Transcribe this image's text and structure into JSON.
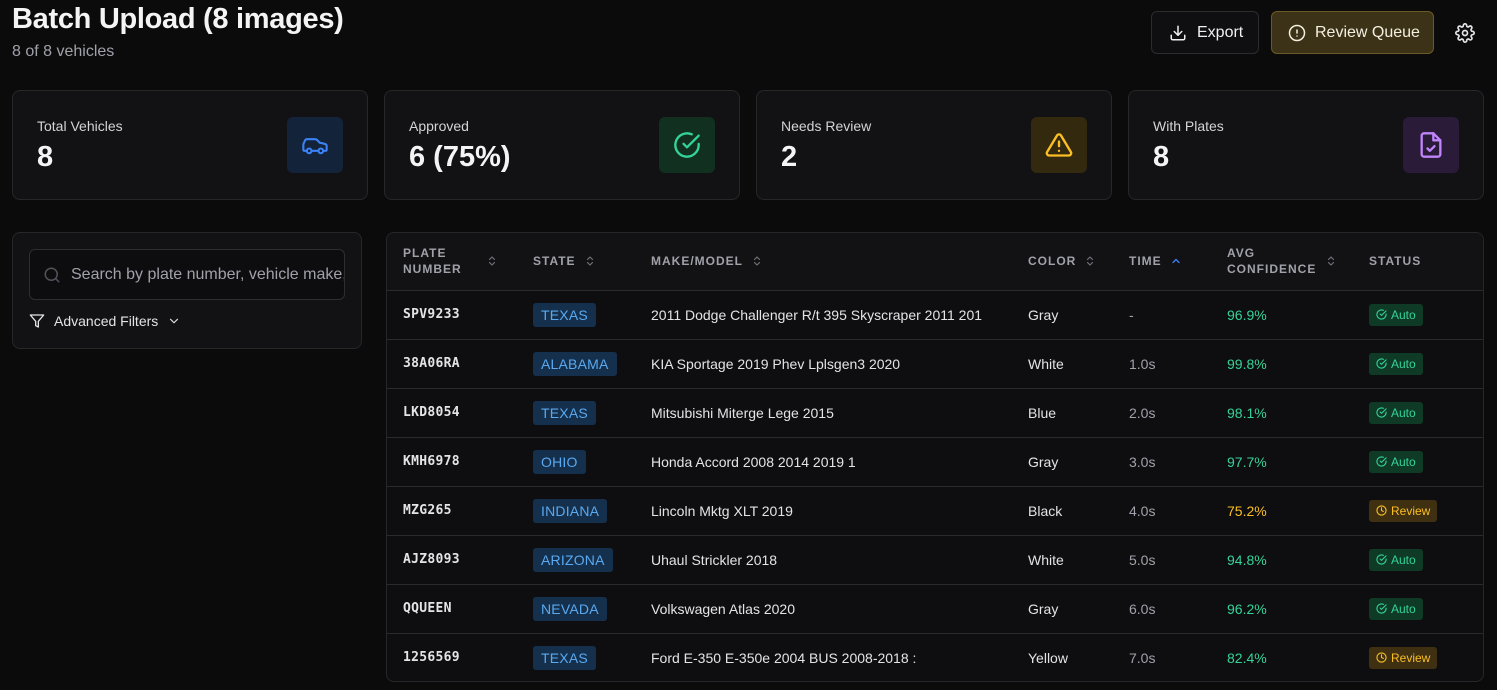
{
  "header": {
    "title": "Batch Upload (8 images)",
    "subtitle": "8 of 8 vehicles"
  },
  "toolbar": {
    "export_label": "Export",
    "review_queue_label": "Review Queue"
  },
  "stats": [
    {
      "label": "Total Vehicles",
      "value": "8",
      "icon": "car-icon",
      "color": "#3b82f6"
    },
    {
      "label": "Approved",
      "value": "6 (75%)",
      "icon": "check-circle-icon",
      "color": "#34d399"
    },
    {
      "label": "Needs Review",
      "value": "2",
      "icon": "warning-triangle-icon",
      "color": "#fbbf24"
    },
    {
      "label": "With Plates",
      "value": "8",
      "icon": "file-check-icon",
      "color": "#c084fc"
    }
  ],
  "filters": {
    "search_placeholder": "Search by plate number, vehicle make, model...",
    "advanced_label": "Advanced Filters"
  },
  "table": {
    "columns": [
      "Plate Number",
      "State",
      "Make/Model",
      "Color",
      "Time",
      "Avg Confidence",
      "Status"
    ],
    "rows": [
      {
        "plate": "SPV9233",
        "state": "TEXAS",
        "make_model": "2011 Dodge Challenger R/t 395 Skyscraper 2011 201",
        "color": "Gray",
        "time": "-",
        "confidence": "96.9%",
        "status": "Auto"
      },
      {
        "plate": "38A06RA",
        "state": "ALABAMA",
        "make_model": "KIA Sportage 2019 Phev Lplsgen3 2020",
        "color": "White",
        "time": "1.0s",
        "confidence": "99.8%",
        "status": "Auto"
      },
      {
        "plate": "LKD8054",
        "state": "TEXAS",
        "make_model": "Mitsubishi Miterge Lege 2015",
        "color": "Blue",
        "time": "2.0s",
        "confidence": "98.1%",
        "status": "Auto"
      },
      {
        "plate": "KMH6978",
        "state": "OHIO",
        "make_model": "Honda Accord 2008 2014 2019 1",
        "color": "Gray",
        "time": "3.0s",
        "confidence": "97.7%",
        "status": "Auto"
      },
      {
        "plate": "MZG265",
        "state": "INDIANA",
        "make_model": "Lincoln Mktg XLT 2019",
        "color": "Black",
        "time": "4.0s",
        "confidence": "75.2%",
        "status": "Review"
      },
      {
        "plate": "AJZ8093",
        "state": "ARIZONA",
        "make_model": "Uhaul Strickler 2018",
        "color": "White",
        "time": "5.0s",
        "confidence": "94.8%",
        "status": "Auto"
      },
      {
        "plate": "QQUEEN",
        "state": "NEVADA",
        "make_model": "Volkswagen Atlas 2020",
        "color": "Gray",
        "time": "6.0s",
        "confidence": "96.2%",
        "status": "Auto"
      },
      {
        "plate": "1256569",
        "state": "TEXAS",
        "make_model": "Ford E-350 E-350e 2004 BUS 2008-2018 :",
        "color": "Yellow",
        "time": "7.0s",
        "confidence": "82.4%",
        "status": "Review"
      }
    ]
  }
}
